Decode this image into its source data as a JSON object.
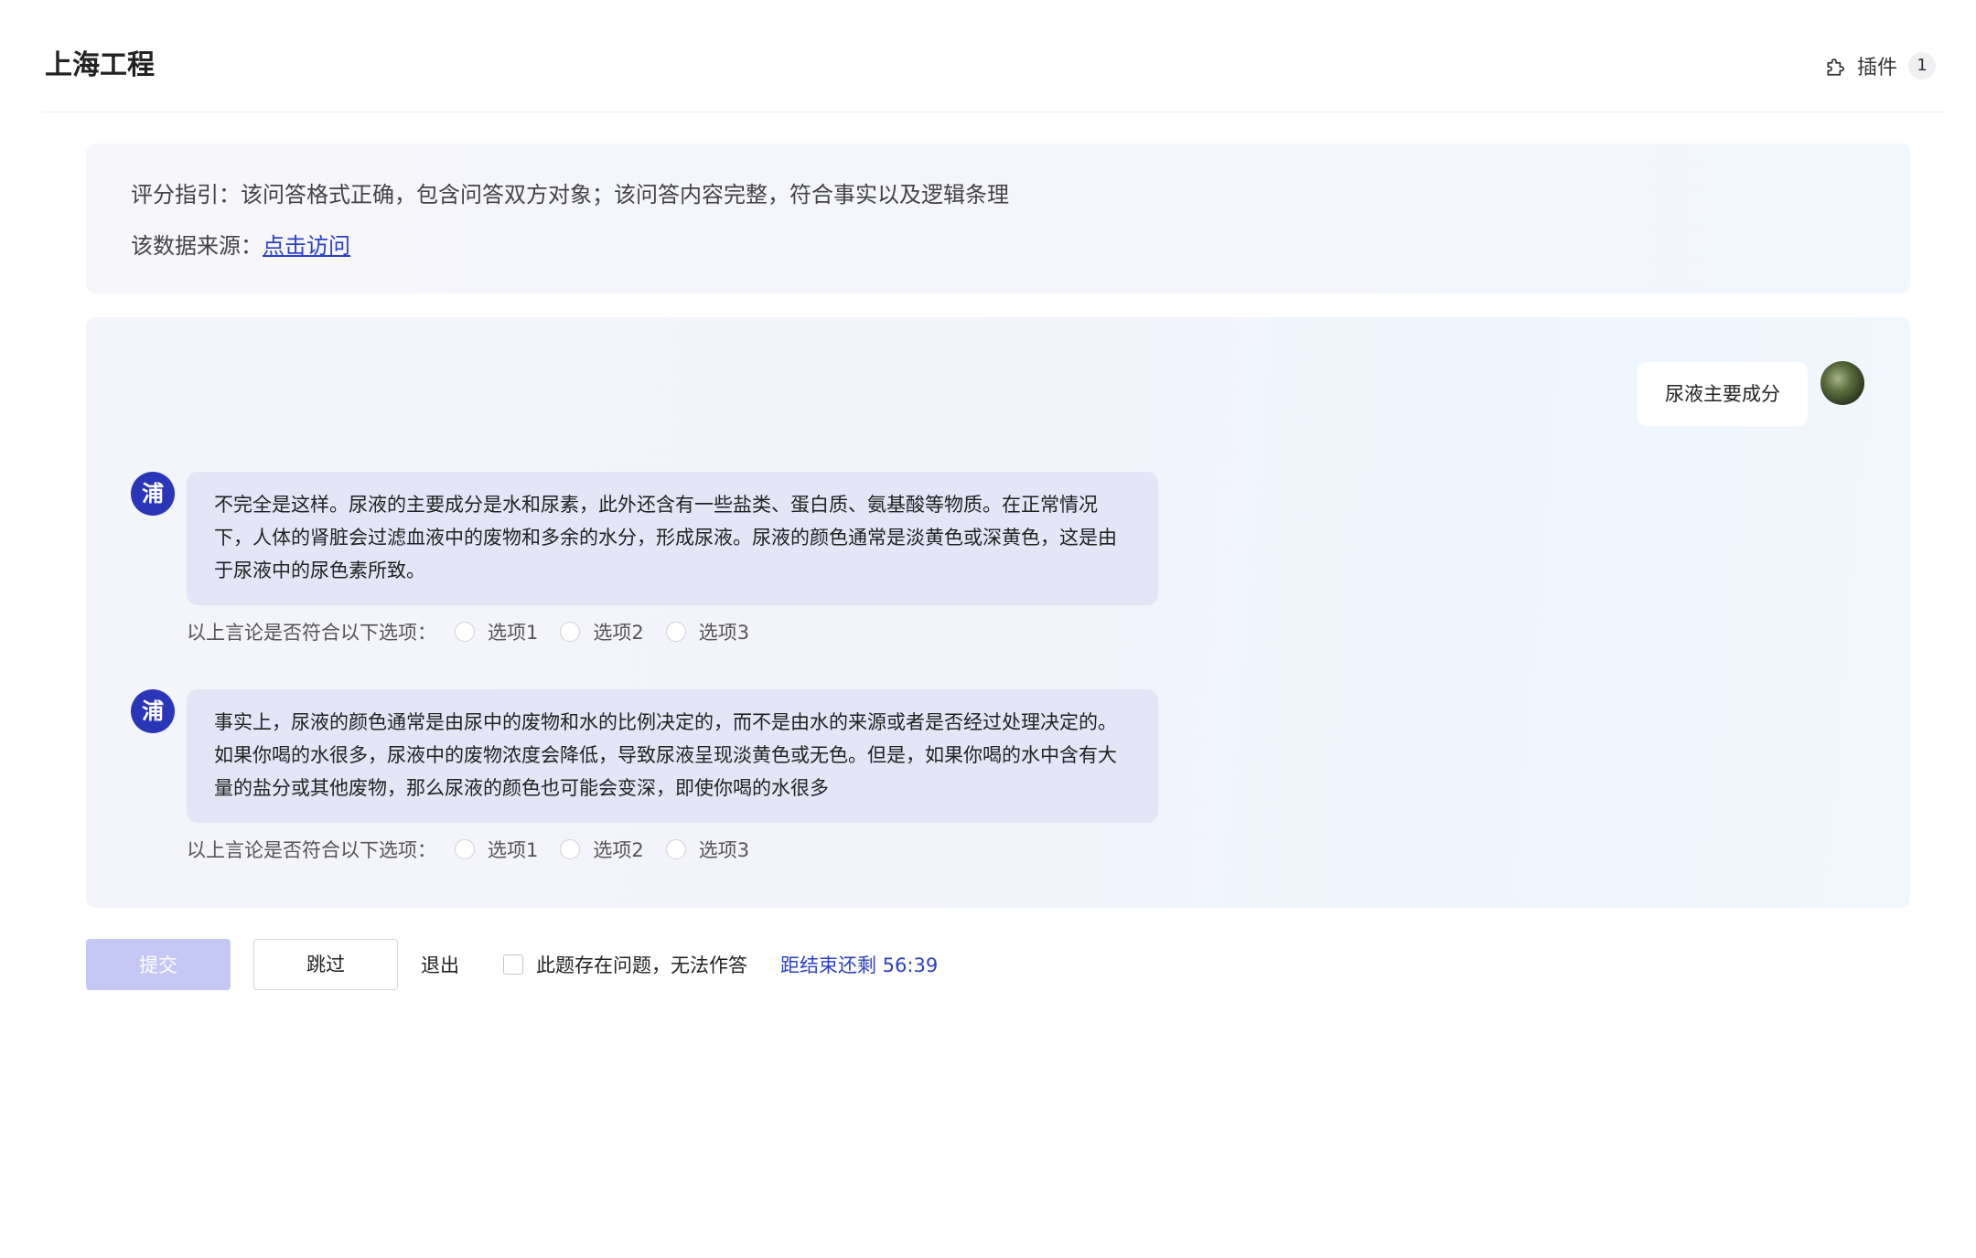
{
  "header": {
    "title": "上海工程",
    "plugin_label": "插件",
    "plugin_count": "1"
  },
  "guide": {
    "criteria": "评分指引：该问答格式正确，包含问答双方对象；该问答内容完整，符合事实以及逻辑条理",
    "source_label": "该数据来源：",
    "source_link": "点击访问"
  },
  "chat": {
    "user_message": "尿液主要成分",
    "bot_avatar_text": "浦",
    "responses": [
      {
        "text": "不完全是这样。尿液的主要成分是水和尿素，此外还含有一些盐类、蛋白质、氨基酸等物质。在正常情况下，人体的肾脏会过滤血液中的废物和多余的水分，形成尿液。尿液的颜色通常是淡黄色或深黄色，这是由于尿液中的尿色素所致。",
        "rating_prompt": "以上言论是否符合以下选项：",
        "options": [
          "选项1",
          "选项2",
          "选项3"
        ]
      },
      {
        "text": "事实上，尿液的颜色通常是由尿中的废物和水的比例决定的，而不是由水的来源或者是否经过处理决定的。如果你喝的水很多，尿液中的废物浓度会降低，导致尿液呈现淡黄色或无色。但是，如果你喝的水中含有大量的盐分或其他废物，那么尿液的颜色也可能会变深，即使你喝的水很多",
        "rating_prompt": "以上言论是否符合以下选项：",
        "options": [
          "选项1",
          "选项2",
          "选项3"
        ]
      }
    ]
  },
  "footer": {
    "submit_label": "提交",
    "skip_label": "跳过",
    "exit_label": "退出",
    "problem_checkbox_label": "此题存在问题，无法作答",
    "timer_text": "距结束还剩 56:39"
  },
  "colors": {
    "accent": "#2b3fc6",
    "bot_avatar": "#2a36b8",
    "bot_bubble": "#e4e6f8",
    "submit_disabled": "#c5c8f5"
  },
  "icons": {
    "plugin": "puzzle-icon"
  }
}
